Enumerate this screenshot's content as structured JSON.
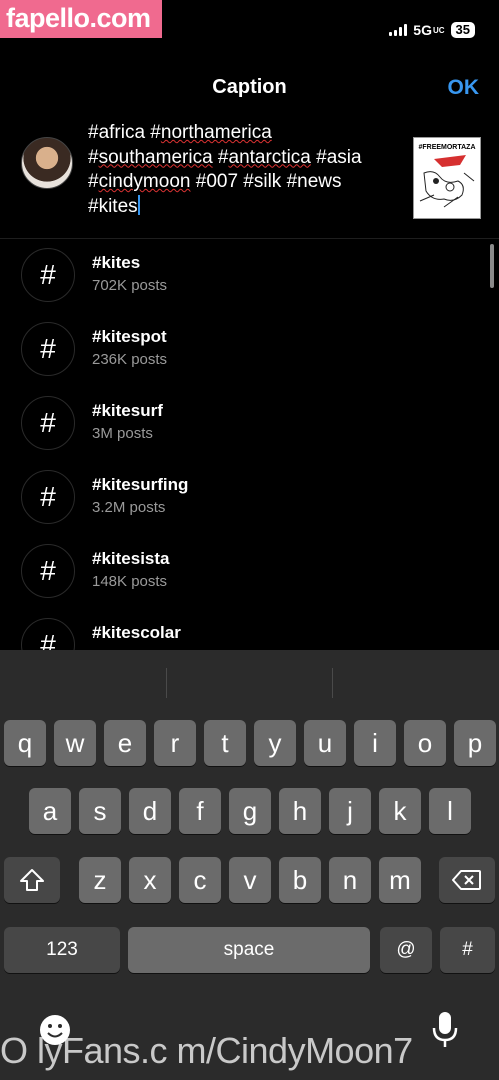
{
  "watermark": {
    "top": "fapello.com",
    "bottom": "O lyFans.c m/CindyMoon7"
  },
  "status": {
    "network": "5G",
    "network_suffix": "UC",
    "battery": "35"
  },
  "header": {
    "title": "Caption",
    "ok_label": "OK"
  },
  "caption": {
    "lines": [
      {
        "text": "#africa #",
        "sq": "northamerica"
      },
      {
        "text": "#",
        "sq": "southamerica",
        "text2": " #",
        "sq2": "antarctica",
        "text3": " #asia"
      },
      {
        "text": "#",
        "sq": "cindymoon",
        "text2": " #007 #silk #news",
        "sq2": "",
        "text3": ""
      },
      {
        "text": "#kites"
      }
    ],
    "thumbnail_title": "#FREEMORTAZA"
  },
  "suggestions": [
    {
      "tag": "#kites",
      "count": "702K posts"
    },
    {
      "tag": "#kitespot",
      "count": "236K posts"
    },
    {
      "tag": "#kitesurf",
      "count": "3M posts"
    },
    {
      "tag": "#kitesurfing",
      "count": "3.2M posts"
    },
    {
      "tag": "#kitesista",
      "count": "148K posts"
    },
    {
      "tag": "#kitescolar",
      "count": ""
    }
  ],
  "keyboard": {
    "row1": [
      "q",
      "w",
      "e",
      "r",
      "t",
      "y",
      "u",
      "i",
      "o",
      "p"
    ],
    "row2": [
      "a",
      "s",
      "d",
      "f",
      "g",
      "h",
      "j",
      "k",
      "l"
    ],
    "row3": [
      "z",
      "x",
      "c",
      "v",
      "b",
      "n",
      "m"
    ],
    "numbers_label": "123",
    "space_label": "space",
    "at_label": "@",
    "hash_label": "#"
  },
  "icons": {
    "shift": "shift-icon",
    "delete": "delete-icon",
    "emoji": "emoji-icon",
    "mic": "microphone-icon",
    "hash": "hashtag-icon"
  },
  "colors": {
    "accent": "#3897f0",
    "logo_bg": "#f06a8f"
  }
}
